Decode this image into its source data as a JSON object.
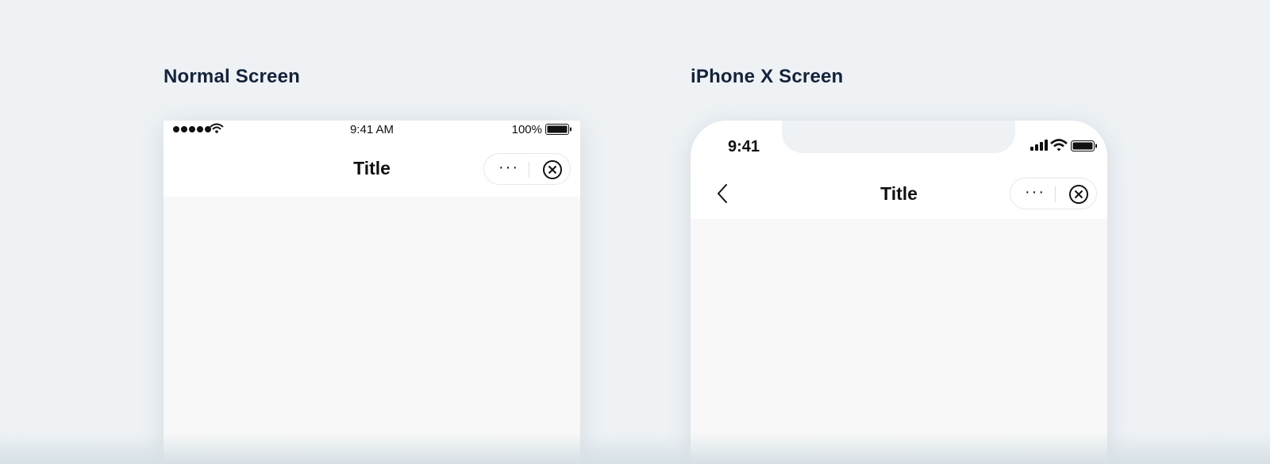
{
  "sections": {
    "normal": {
      "label": "Normal Screen"
    },
    "iphonex": {
      "label": "iPhone X Screen"
    }
  },
  "normal_phone": {
    "status_bar": {
      "time": "9:41 AM",
      "battery_percent": "100%"
    },
    "nav_bar": {
      "title": "Title",
      "more_label": "···"
    }
  },
  "iphonex_phone": {
    "status_bar": {
      "time": "9:41"
    },
    "nav_bar": {
      "title": "Title",
      "more_label": "···"
    }
  },
  "colors": {
    "background": "#eef2f5",
    "heading": "#15233a",
    "content_bg": "#f8f8f8",
    "bar_bg": "#ffffff"
  },
  "icons": [
    "signal-dots-icon",
    "wifi-icon",
    "battery-icon",
    "cellular-icon",
    "back-chevron-icon",
    "close-circle-icon"
  ]
}
